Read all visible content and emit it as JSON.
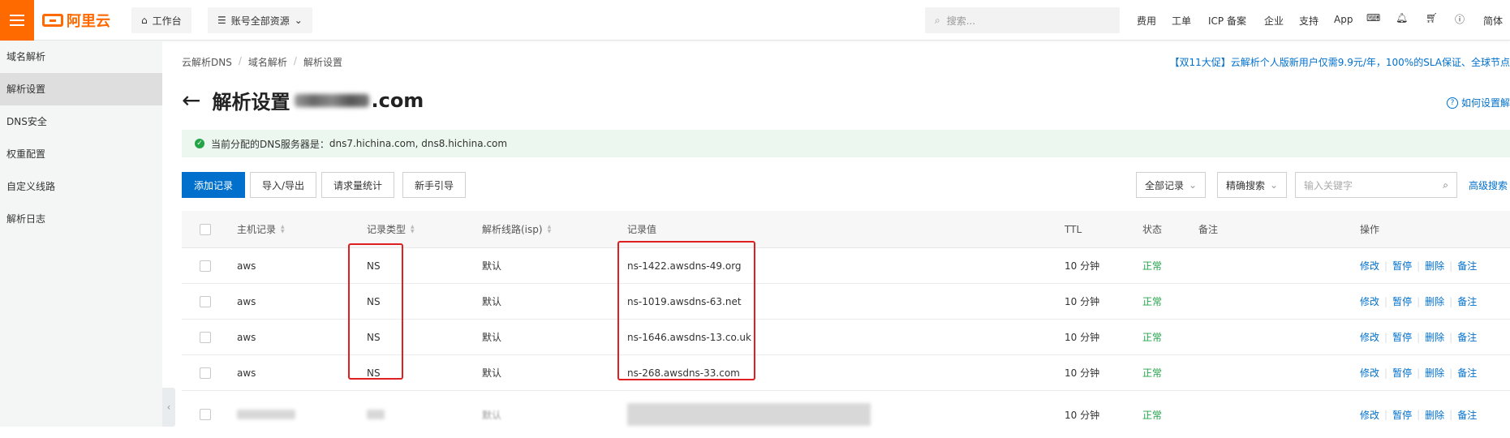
{
  "topbar": {
    "logo_text": "阿里云",
    "workbench_label": "工作台",
    "resources_label": "账号全部资源",
    "search_placeholder": "搜索...",
    "links": [
      "费用",
      "工单",
      "ICP 备案",
      "企业",
      "支持",
      "App"
    ],
    "lang": "简体"
  },
  "sidebar": {
    "items": [
      {
        "label": "域名解析"
      },
      {
        "label": "解析设置"
      },
      {
        "label": "DNS安全"
      },
      {
        "label": "权重配置"
      },
      {
        "label": "自定义线路"
      },
      {
        "label": "解析日志"
      }
    ]
  },
  "breadcrumb": [
    "云解析DNS",
    "域名解析",
    "解析设置"
  ],
  "promo": "【双11大促】云解析个人版新用户仅需9.9元/年，100%的SLA保证、全球节点",
  "page_title": {
    "prefix": "解析设置",
    "domain_suffix": ".com"
  },
  "howto": "如何设置解",
  "notice": {
    "label": "当前分配的DNS服务器是：",
    "servers": "dns7.hichina.com, dns8.hichina.com"
  },
  "toolbar": {
    "add_record": "添加记录",
    "import_export": "导入/导出",
    "request_stats": "请求量统计",
    "beginner_guide": "新手引导",
    "all_records": "全部记录",
    "exact_search": "精确搜索",
    "keyword_placeholder": "输入关键字",
    "advanced_search": "高级搜索"
  },
  "table": {
    "headers": {
      "host": "主机记录",
      "type": "记录类型",
      "line": "解析线路(isp)",
      "value": "记录值",
      "ttl": "TTL",
      "status": "状态",
      "remark": "备注",
      "actions": "操作"
    },
    "rows": [
      {
        "host": "aws",
        "type": "NS",
        "line": "默认",
        "value": "ns-1422.awsdns-49.org",
        "ttl": "10 分钟",
        "status": "正常"
      },
      {
        "host": "aws",
        "type": "NS",
        "line": "默认",
        "value": "ns-1019.awsdns-63.net",
        "ttl": "10 分钟",
        "status": "正常"
      },
      {
        "host": "aws",
        "type": "NS",
        "line": "默认",
        "value": "ns-1646.awsdns-13.co.uk",
        "ttl": "10 分钟",
        "status": "正常"
      },
      {
        "host": "aws",
        "type": "NS",
        "line": "默认",
        "value": "ns-268.awsdns-33.com",
        "ttl": "10 分钟",
        "status": "正常"
      }
    ],
    "partial_row": {
      "line": "默认",
      "ttl": "10 分钟",
      "status": "正常"
    },
    "row_actions": [
      "修改",
      "暂停",
      "删除",
      "备注"
    ]
  },
  "colors": {
    "brand": "#ff6a00",
    "primary": "#0070cc",
    "success": "#22a447",
    "highlight": "#e02020"
  }
}
